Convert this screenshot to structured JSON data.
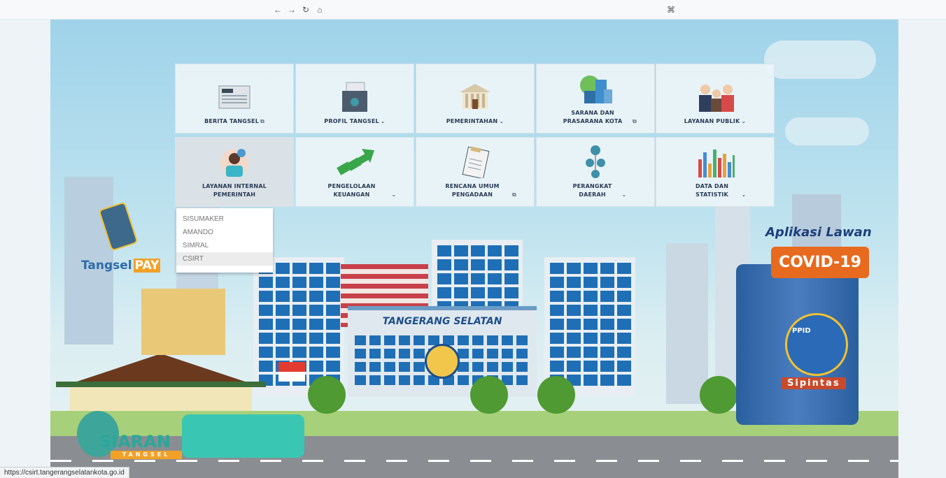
{
  "browser": {
    "back_icon": "←",
    "forward_icon": "→",
    "reload_icon": "↻",
    "home_icon": "⌂",
    "extension_icon": "⌘"
  },
  "menu": {
    "tiles": [
      {
        "label": "BERITA TANGSEL",
        "suffix": "external-link",
        "icon": "newspaper-icon"
      },
      {
        "label": "PROFIL TANGSEL",
        "suffix": "chevron-down",
        "icon": "folder-icon"
      },
      {
        "label": "PEMERINTAHAN",
        "suffix": "chevron-down",
        "icon": "government-building-icon"
      },
      {
        "label": "SARANA DAN PRASARANA KOTA",
        "suffix": "external-link",
        "icon": "city-buildings-icon"
      },
      {
        "label": "LAYANAN PUBLIK",
        "suffix": "chevron-down",
        "icon": "people-icon"
      },
      {
        "label": "LAYANAN INTERNAL PEMERINTAH",
        "suffix": "",
        "icon": "customer-service-icon"
      },
      {
        "label": "PENGELOLAAN KEUANGAN",
        "suffix": "chevron-down",
        "icon": "money-growth-icon"
      },
      {
        "label": "RENCANA UMUM PENGADAAN",
        "suffix": "external-link",
        "icon": "clipboard-icon"
      },
      {
        "label": "PERANGKAT DAERAH",
        "suffix": "chevron-down",
        "icon": "org-structure-icon"
      },
      {
        "label": "DATA DAN STATISTIK",
        "suffix": "chevron-down",
        "icon": "bar-chart-icon"
      }
    ]
  },
  "dropdown": {
    "items": [
      "SISUMAKER",
      "AMANDO",
      "SIMRAL",
      "CSIRT"
    ]
  },
  "scene": {
    "building_sign": "TANGERANG SELATAN",
    "tangsel_pay_text1": "Tangsel",
    "tangsel_pay_text2": "PAY",
    "covid_title": "Aplikasi Lawan",
    "covid_badge": "COVID-19",
    "sipintas": "Sipintas",
    "ppid": "PPID",
    "siaran_title": "SIARAN",
    "siaran_sub": "TANGSEL"
  },
  "status": {
    "url": "https://csirt.tangerangselatankota.go.id"
  },
  "colors": {
    "primary_label": "#2a3a55",
    "window_blue": "#1f6fb6",
    "covid_orange": "#e86a1e"
  }
}
